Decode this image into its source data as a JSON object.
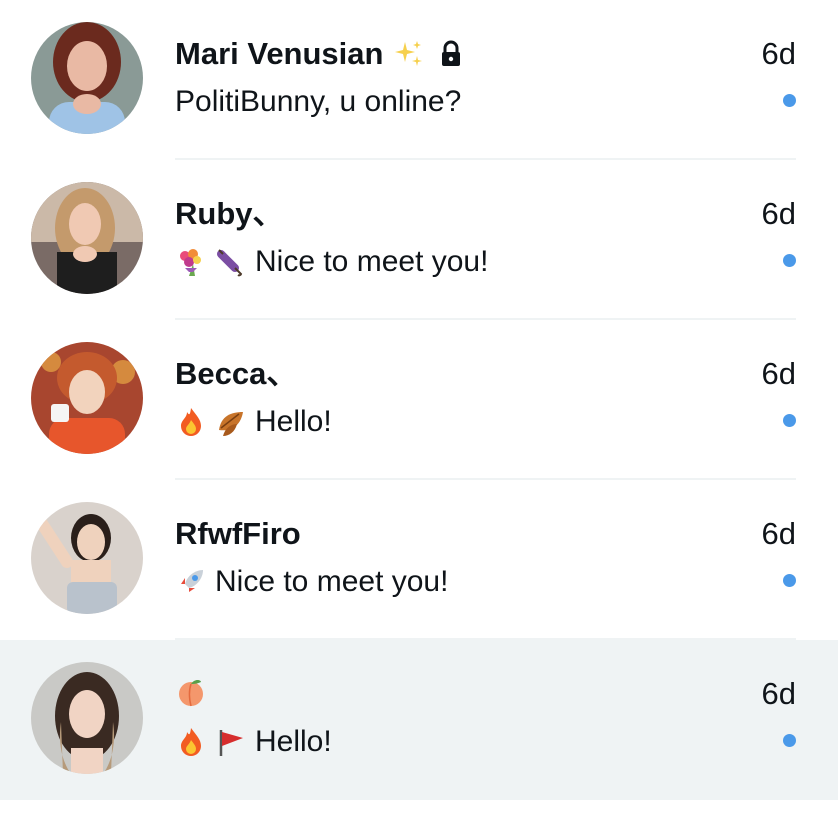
{
  "colors": {
    "unread_dot": "#4a99e9",
    "highlight_row": "#eff3f4",
    "divider": "#eff3f4",
    "text": "#0f1419"
  },
  "conversations": [
    {
      "name": "Mari Venusian",
      "name_icons": [
        "sparkles-icon",
        "lock-icon"
      ],
      "time": "6d",
      "preview_icons": [],
      "preview": "PolitiBunny, u online?",
      "unread": true
    },
    {
      "name": "Ruby、",
      "name_icons": [],
      "time": "6d",
      "preview_icons": [
        "bouquet-icon",
        "umbrella-icon"
      ],
      "preview": "Nice to meet you!",
      "unread": true
    },
    {
      "name": "Becca、",
      "name_icons": [],
      "time": "6d",
      "preview_icons": [
        "fire-icon",
        "leaves-icon"
      ],
      "preview": "Hello!",
      "unread": true
    },
    {
      "name": "RfwfFiro",
      "name_icons": [],
      "time": "6d",
      "preview_icons": [
        "rocket-icon"
      ],
      "preview": "Nice to meet you!",
      "unread": true
    },
    {
      "name": "",
      "name_icons": [
        "peach-icon"
      ],
      "time": "6d",
      "preview_icons": [
        "fire-icon",
        "flag-icon"
      ],
      "preview": "Hello!",
      "unread": true,
      "highlighted": true
    }
  ]
}
